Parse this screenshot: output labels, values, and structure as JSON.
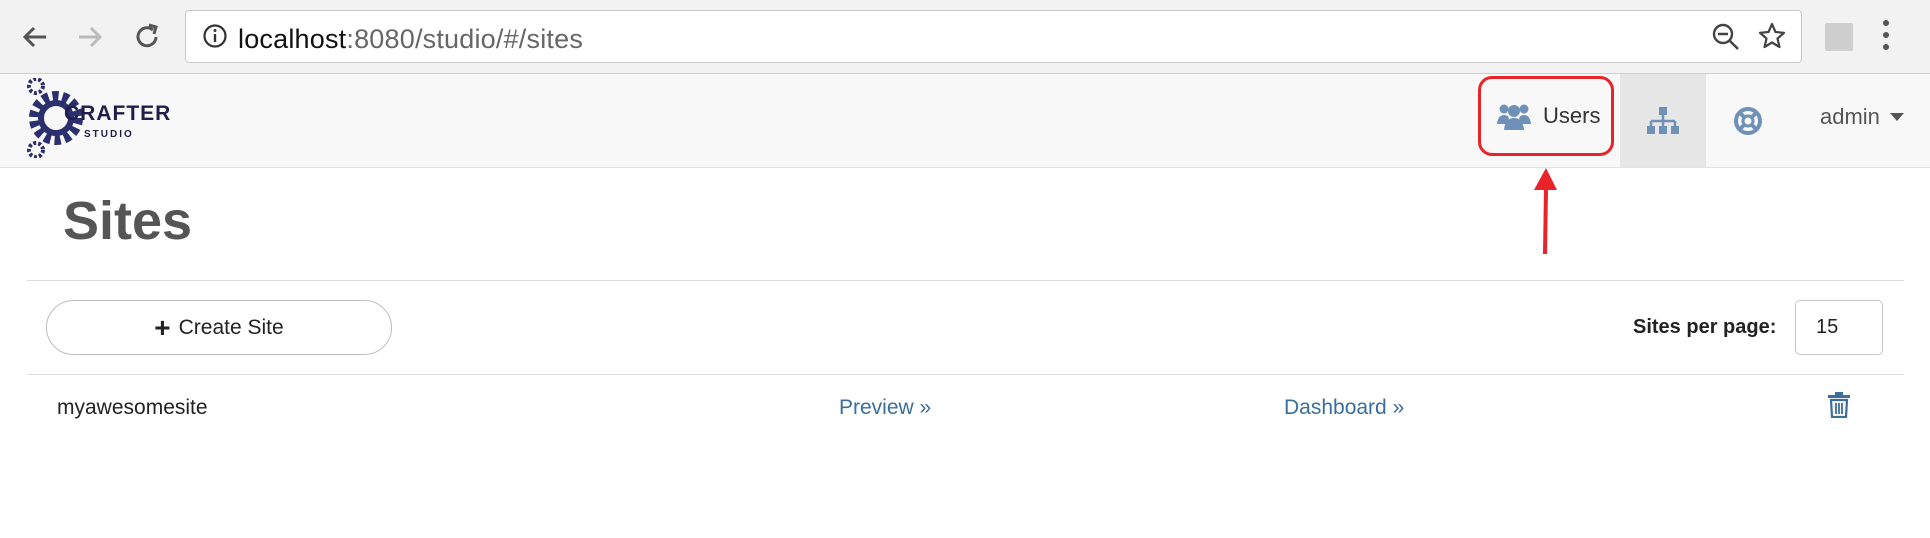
{
  "browser": {
    "url_host": "localhost",
    "url_path": ":8080/studio/#/sites"
  },
  "header": {
    "logo_text": "CRAFTER",
    "logo_subtext": "STUDIO",
    "users_label": "Users",
    "user_menu_label": "admin"
  },
  "main": {
    "title": "Sites",
    "create_site_label": "Create Site",
    "sites_per_page_label": "Sites per page:",
    "sites_per_page_value": "15",
    "sites": [
      {
        "name": "myawesomesite",
        "preview_label": "Preview »",
        "dashboard_label": "Dashboard »"
      }
    ]
  },
  "colors": {
    "link": "#3b6e9a",
    "highlight": "#e8232a",
    "icon_blue": "#6f91b8"
  }
}
